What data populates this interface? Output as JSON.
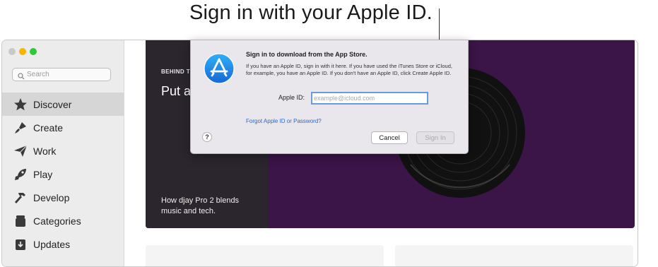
{
  "callout": {
    "text": "Sign in with your Apple ID."
  },
  "sidebar": {
    "search_placeholder": "Search",
    "items": [
      {
        "label": "Discover",
        "icon": "star-icon",
        "active": true
      },
      {
        "label": "Create",
        "icon": "paintbrush-icon",
        "active": false
      },
      {
        "label": "Work",
        "icon": "paper-plane-icon",
        "active": false
      },
      {
        "label": "Play",
        "icon": "rocket-icon",
        "active": false
      },
      {
        "label": "Develop",
        "icon": "hammer-icon",
        "active": false
      },
      {
        "label": "Categories",
        "icon": "stack-icon",
        "active": false
      },
      {
        "label": "Updates",
        "icon": "download-icon",
        "active": false
      }
    ]
  },
  "hero": {
    "eyebrow": "BEHIND T",
    "title": "Put a",
    "subtitle": "How djay Pro 2 blends music and tech."
  },
  "dialog": {
    "heading": "Sign in to download from the App Store.",
    "body": "If you have an Apple ID, sign in with it here. If you have used the iTunes Store or iCloud, for example, you have an Apple ID. If you don't have an Apple ID, click Create Apple ID.",
    "apple_id_label": "Apple ID:",
    "apple_id_placeholder": "example@icloud.com",
    "apple_id_value": "",
    "forgot_link": "Forgot Apple ID or Password?",
    "help_label": "?",
    "cancel_label": "Cancel",
    "signin_label": "Sign In"
  },
  "colors": {
    "accent_blue": "#2a6acb",
    "hero_purple": "#3b1448",
    "traffic_yellow": "#f5b500",
    "traffic_green": "#2ec93a"
  }
}
